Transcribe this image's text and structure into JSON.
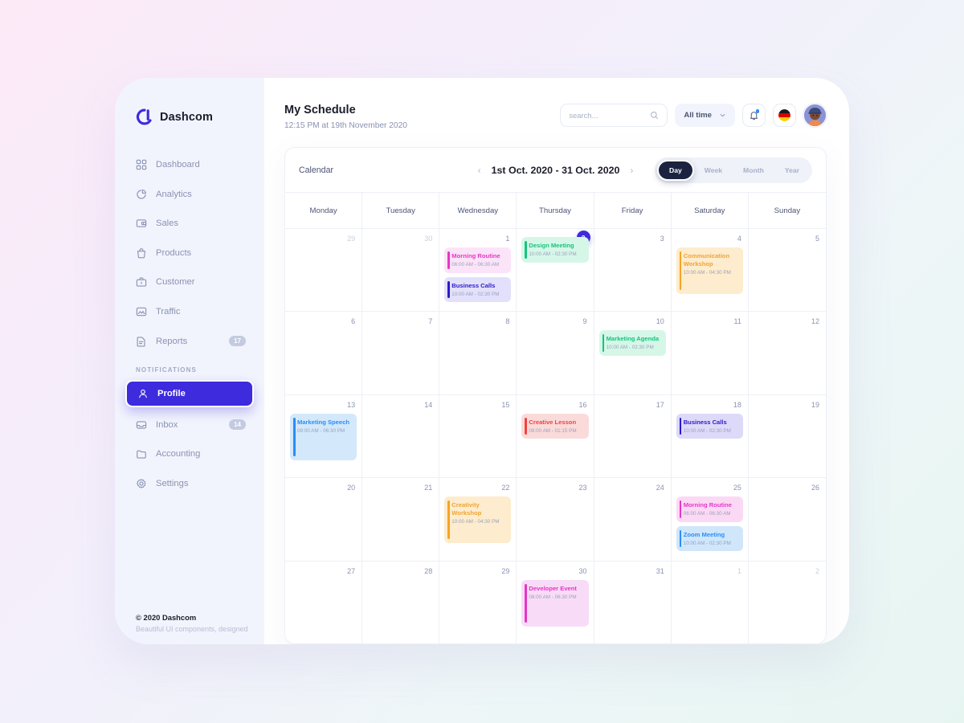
{
  "brand": {
    "name": "Dashcom",
    "logo_icon": "dashcom-logo-icon"
  },
  "sidebar": {
    "items": [
      {
        "label": "Dashboard",
        "icon": "grid-icon",
        "badge": null,
        "active": false
      },
      {
        "label": "Analytics",
        "icon": "pie-chart-icon",
        "badge": null,
        "active": false
      },
      {
        "label": "Sales",
        "icon": "wallet-icon",
        "badge": null,
        "active": false
      },
      {
        "label": "Products",
        "icon": "bag-icon",
        "badge": null,
        "active": false
      },
      {
        "label": "Customer",
        "icon": "briefcase-icon",
        "badge": null,
        "active": false
      },
      {
        "label": "Traffic",
        "icon": "image-chart-icon",
        "badge": null,
        "active": false
      },
      {
        "label": "Reports",
        "icon": "document-icon",
        "badge": "17",
        "active": false
      }
    ],
    "section_label": "NOTIFICATIONS",
    "items2": [
      {
        "label": "Profile",
        "icon": "user-icon",
        "badge": null,
        "active": true
      },
      {
        "label": "Inbox",
        "icon": "inbox-icon",
        "badge": "14",
        "active": false
      },
      {
        "label": "Accounting",
        "icon": "folder-icon",
        "badge": null,
        "active": false
      },
      {
        "label": "Settings",
        "icon": "gear-icon",
        "badge": null,
        "active": false
      }
    ],
    "footer": {
      "copyright": "© 2020 Dashcom",
      "tagline": "Beautiful UI components, designed"
    }
  },
  "header": {
    "title": "My Schedule",
    "subtitle": "12:15 PM at 19th November 2020",
    "search_placeholder": "search...",
    "search_value": "",
    "search_icon": "search-icon",
    "filter_label": "All time",
    "filter_caret": "chevron-down-icon",
    "bell_icon": "bell-icon",
    "flag_icon": "germany-flag-icon",
    "avatar_icon": "user-avatar"
  },
  "calendar": {
    "card_title": "Calendar",
    "range": "1st Oct. 2020 - 31 Oct. 2020",
    "prev_icon": "chevron-left-icon",
    "next_icon": "chevron-right-icon",
    "views": [
      {
        "label": "Day",
        "active": true
      },
      {
        "label": "Week",
        "active": false
      },
      {
        "label": "Month",
        "active": false
      },
      {
        "label": "Year",
        "active": false
      }
    ],
    "day_names": [
      "Monday",
      "Tuesday",
      "Wednesday",
      "Thursday",
      "Friday",
      "Saturday",
      "Sunday"
    ],
    "colors": {
      "pink": "#e536c8",
      "indigo": "#3d2bdd",
      "green": "#15c47e",
      "orange": "#f5a524",
      "blue": "#2b8ef5",
      "red": "#f0443e",
      "magenta": "#e536c8",
      "today": "#3d2bdd"
    },
    "weeks": [
      [
        {
          "num": "29",
          "muted": true,
          "today": false,
          "events": []
        },
        {
          "num": "30",
          "muted": true,
          "today": false,
          "events": []
        },
        {
          "num": "1",
          "muted": false,
          "today": false,
          "events": [
            {
              "title": "Morning Routine",
              "time": "06:00 AM - 06:30 AM",
              "bg": "#fbe3f8",
              "bar": "#e536c8",
              "color": "#e536c8",
              "tall": false
            },
            {
              "title": "Business Calls",
              "time": "10:00 AM - 02:30 PM",
              "bg": "#e3e0fb",
              "bar": "#2a1bc9",
              "color": "#2a1bc9",
              "tall": false
            }
          ]
        },
        {
          "num": "2",
          "muted": false,
          "today": true,
          "events": [
            {
              "title": "Design Meeting",
              "time": "10:00 AM - 02:30 PM",
              "bg": "#d6f7e8",
              "bar": "#15c47e",
              "color": "#15c47e",
              "tall": false
            }
          ]
        },
        {
          "num": "3",
          "muted": false,
          "today": false,
          "events": []
        },
        {
          "num": "4",
          "muted": false,
          "today": false,
          "events": [
            {
              "title": "Communication Workshop",
              "time": "10:00 AM - 04:30 PM",
              "bg": "#fdeccd",
              "bar": "#f5a524",
              "color": "#f0a433",
              "tall": true
            }
          ]
        },
        {
          "num": "5",
          "muted": false,
          "today": false,
          "events": []
        }
      ],
      [
        {
          "num": "6",
          "muted": false,
          "today": false,
          "events": []
        },
        {
          "num": "7",
          "muted": false,
          "today": false,
          "events": []
        },
        {
          "num": "8",
          "muted": false,
          "today": false,
          "events": []
        },
        {
          "num": "9",
          "muted": false,
          "today": false,
          "events": []
        },
        {
          "num": "10",
          "muted": false,
          "today": false,
          "events": [
            {
              "title": "Marketing Agenda",
              "time": "10:00 AM - 02:30 PM",
              "bg": "#d6f7e8",
              "bar": "#15c47e",
              "color": "#15c47e",
              "tall": false
            }
          ]
        },
        {
          "num": "11",
          "muted": false,
          "today": false,
          "events": []
        },
        {
          "num": "12",
          "muted": false,
          "today": false,
          "events": []
        }
      ],
      [
        {
          "num": "13",
          "muted": false,
          "today": false,
          "events": [
            {
              "title": "Marketing Speech",
              "time": "08:00 AM - 06:30 PM",
              "bg": "#d3e8fb",
              "bar": "#2b8ef5",
              "color": "#2b8ef5",
              "tall": true
            }
          ]
        },
        {
          "num": "14",
          "muted": false,
          "today": false,
          "events": []
        },
        {
          "num": "15",
          "muted": false,
          "today": false,
          "events": []
        },
        {
          "num": "16",
          "muted": false,
          "today": false,
          "events": [
            {
              "title": "Creative Lesson",
              "time": "08:00 AM - 01:15 PM",
              "bg": "#fbdada",
              "bar": "#f0443e",
              "color": "#f0443e",
              "tall": false
            }
          ]
        },
        {
          "num": "17",
          "muted": false,
          "today": false,
          "events": []
        },
        {
          "num": "18",
          "muted": false,
          "today": false,
          "events": [
            {
              "title": "Business Calls",
              "time": "10:00 AM - 02:30 PM",
              "bg": "#ddd9f8",
              "bar": "#2a1bc9",
              "color": "#2a1bc9",
              "tall": false
            }
          ]
        },
        {
          "num": "19",
          "muted": false,
          "today": false,
          "events": []
        }
      ],
      [
        {
          "num": "20",
          "muted": false,
          "today": false,
          "events": []
        },
        {
          "num": "21",
          "muted": false,
          "today": false,
          "events": []
        },
        {
          "num": "22",
          "muted": false,
          "today": false,
          "events": [
            {
              "title": "Creativity Workshop",
              "time": "10:00 AM - 04:30 PM",
              "bg": "#fdeccd",
              "bar": "#f5a524",
              "color": "#f0a433",
              "tall": true
            }
          ]
        },
        {
          "num": "23",
          "muted": false,
          "today": false,
          "events": []
        },
        {
          "num": "24",
          "muted": false,
          "today": false,
          "events": []
        },
        {
          "num": "25",
          "muted": false,
          "today": false,
          "events": [
            {
              "title": "Morning Routine",
              "time": "06:00 AM - 06:30 AM",
              "bg": "#fbd9f5",
              "bar": "#e536c8",
              "color": "#e536c8",
              "tall": false
            },
            {
              "title": "Zoom Meeting",
              "time": "10:00 AM - 02:30 PM",
              "bg": "#cfe6fb",
              "bar": "#2b8ef5",
              "color": "#2b8ef5",
              "tall": false
            }
          ]
        },
        {
          "num": "26",
          "muted": false,
          "today": false,
          "events": []
        }
      ],
      [
        {
          "num": "27",
          "muted": false,
          "today": false,
          "events": []
        },
        {
          "num": "28",
          "muted": false,
          "today": false,
          "events": []
        },
        {
          "num": "29",
          "muted": false,
          "today": false,
          "events": []
        },
        {
          "num": "30",
          "muted": false,
          "today": false,
          "events": [
            {
              "title": "Developer Event",
              "time": "08:00 AM - 06:30 PM",
              "bg": "#f8dcf7",
              "bar": "#e536c8",
              "color": "#e536c8",
              "tall": true
            }
          ]
        },
        {
          "num": "31",
          "muted": false,
          "today": false,
          "events": []
        },
        {
          "num": "1",
          "muted": true,
          "today": false,
          "events": []
        },
        {
          "num": "2",
          "muted": true,
          "today": false,
          "events": []
        }
      ]
    ]
  }
}
